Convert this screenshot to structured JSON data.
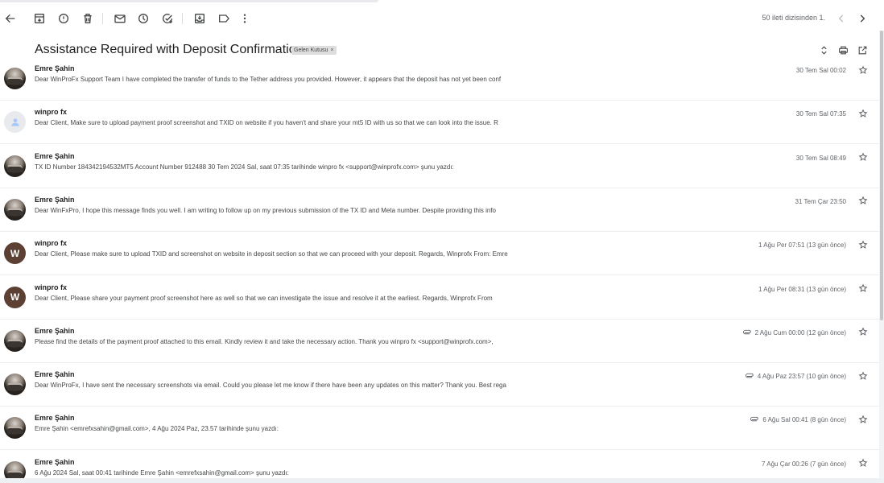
{
  "toolbar": {
    "buttons": [
      "back-icon",
      "archive-icon",
      "report-spam-icon",
      "delete-icon",
      "mark-unread-icon",
      "snooze-icon",
      "add-task-icon",
      "move-to-icon",
      "label-icon",
      "more-vert-icon"
    ],
    "pager": "50 ileti dizisinden 1.",
    "pager_prev_icon": "chevron-left-icon",
    "pager_next_icon": "chevron-right-icon"
  },
  "thread": {
    "subject": "Assistance Required with Deposit Confirmation",
    "label": "Gelen Kutusu",
    "label_remove": "×",
    "actions": [
      "expand-collapse-icon",
      "print-icon",
      "open-new-window-icon"
    ]
  },
  "messages": [
    {
      "avatar": "photo",
      "avatar_letter": "",
      "sender": "Emre Şahin",
      "snippet": "Dear WinProFx Support Team I have completed the transfer of funds to the Tether address you provided. However, it appears that the deposit has not yet been conf",
      "date": "30 Tem Sal 00:02",
      "attachment": false
    },
    {
      "avatar": "blank",
      "avatar_letter": "",
      "sender": "winpro fx",
      "snippet": "Dear Client, Make sure to upload payment proof screenshot and TXID on website if you haven't and share your mt5 ID with us so that we can look into the issue. R",
      "date": "30 Tem Sal 07:35",
      "attachment": false
    },
    {
      "avatar": "photo",
      "avatar_letter": "",
      "sender": "Emre Şahin",
      "snippet": "TX ID Number 184342194532MT5 Account Number 912488 30 Tem 2024 Sal, saat 07:35 tarihinde winpro fx <support@winprofx.com> şunu yazdı:",
      "date": "30 Tem Sal 08:49",
      "attachment": false
    },
    {
      "avatar": "photo",
      "avatar_letter": "",
      "sender": "Emre Şahin",
      "snippet": "Dear WinFxPro, I hope this message finds you well. I am writing to follow up on my previous submission of the TX ID and Meta number. Despite providing this info",
      "date": "31 Tem Çar 23:50",
      "attachment": false
    },
    {
      "avatar": "letter",
      "avatar_letter": "W",
      "sender": "winpro fx",
      "snippet": "Dear Client, Please make sure to upload TXID and screenshot on website in deposit section so that we can proceed with your deposit. Regards, Winprofx From: Emre",
      "date": "1 Ağu Per 07:51 (13 gün önce)",
      "attachment": false
    },
    {
      "avatar": "letter",
      "avatar_letter": "W",
      "sender": "winpro fx",
      "snippet": "Dear Client, Please share your payment proof screenshot here as well so that we can investigate the issue and resolve it at the earliest. Regards, Winprofx From",
      "date": "1 Ağu Per 08:31 (13 gün önce)",
      "attachment": false
    },
    {
      "avatar": "photo",
      "avatar_letter": "",
      "sender": "Emre Şahin",
      "snippet": "Please find the details of the payment proof attached to this email. Kindly review it and take the necessary action. Thank you winpro fx <support@winprofx.com>,",
      "date": "2 Ağu Cum 00:00 (12 gün önce)",
      "attachment": true
    },
    {
      "avatar": "photo",
      "avatar_letter": "",
      "sender": "Emre Şahin",
      "snippet": "Dear WinProFx, I have sent the necessary screenshots via email. Could you please let me know if there have been any updates on this matter? Thank you. Best rega",
      "date": "4 Ağu Paz 23:57 (10 gün önce)",
      "attachment": true
    },
    {
      "avatar": "photo",
      "avatar_letter": "",
      "sender": "Emre Şahin",
      "snippet": "Emre Şahin <emrefxsahin@gmail.com>, 4 Ağu 2024 Paz, 23.57 tarihinde şunu yazdı:",
      "date": "6 Ağu Sal 00:41 (8 gün önce)",
      "attachment": true
    },
    {
      "avatar": "photo",
      "avatar_letter": "",
      "sender": "Emre Şahin",
      "snippet": "6 Ağu 2024 Sal, saat 00:41 tarihinde Emre Şahin <emrefxsahin@gmail.com> şunu yazdı:",
      "date": "7 Ağu Çar 00:26 (7 gün önce)",
      "attachment": false
    }
  ]
}
